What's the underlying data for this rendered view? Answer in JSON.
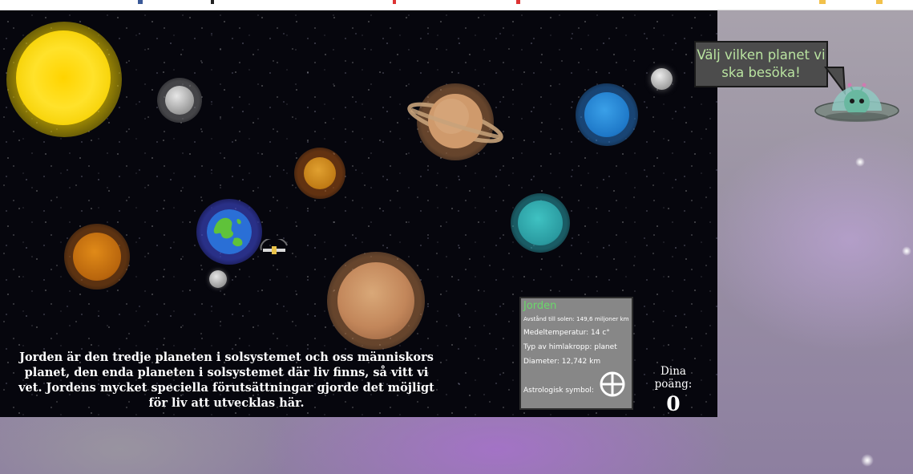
{
  "planet_info": {
    "name": "Jorden",
    "distance": "Avstånd till solen: 149,6 miljoner km",
    "temperature": "Medeltemperatur: 14 c°",
    "type": "Typ av himlakropp: planet",
    "diameter": "Diameter: 12,742 km",
    "astro_label": "Astrologisk symbol:",
    "astro_symbol_icon": "earth-symbol-icon"
  },
  "description": "Jorden är den tredje planeten i solsystemet och oss människors planet, den enda planeten i solsystemet där liv finns, så vitt vi vet. Jordens mycket speciella förutsättningar gjorde det möjligt för liv att utvecklas här.",
  "score": {
    "label": "Dina poäng:",
    "value": "0"
  },
  "guide": {
    "speech": "Välj vilken planet vi ska besöka!",
    "character_icon": "alien-ufo-icon"
  },
  "colors": {
    "space": "#06060d",
    "title_green": "#6ad86a",
    "speech_green": "#b9e3a0",
    "infobox_bg": "#878787"
  }
}
